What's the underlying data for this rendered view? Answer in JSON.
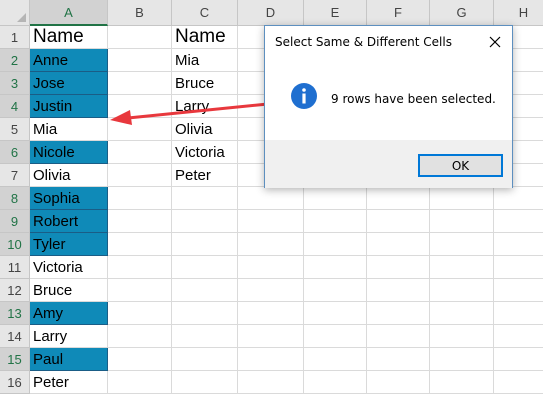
{
  "columns": [
    "A",
    "B",
    "C",
    "D",
    "E",
    "F",
    "G",
    "H"
  ],
  "rows": [
    "1",
    "2",
    "3",
    "4",
    "5",
    "6",
    "7",
    "8",
    "9",
    "10",
    "11",
    "12",
    "13",
    "14",
    "15",
    "16"
  ],
  "column_a": [
    "Name",
    "Anne",
    "Jose",
    "Justin",
    "Mia",
    "Nicole",
    "Olivia",
    "Sophia",
    "Robert",
    "Tyler",
    "Victoria",
    "Bruce",
    "Amy",
    "Larry",
    "Paul",
    "Peter"
  ],
  "column_c": [
    "Name",
    "Mia",
    "Bruce",
    "Larry",
    "Olivia",
    "Victoria",
    "Peter"
  ],
  "highlight_color": "#0f8ab8",
  "selected_header_color": "#217346",
  "arrow_color": "#e8383d",
  "dialog": {
    "title": "Select Same & Different Cells",
    "message": "9 rows have been selected.",
    "ok_label": "OK",
    "icon": "info-icon",
    "close_icon": "close-icon"
  }
}
